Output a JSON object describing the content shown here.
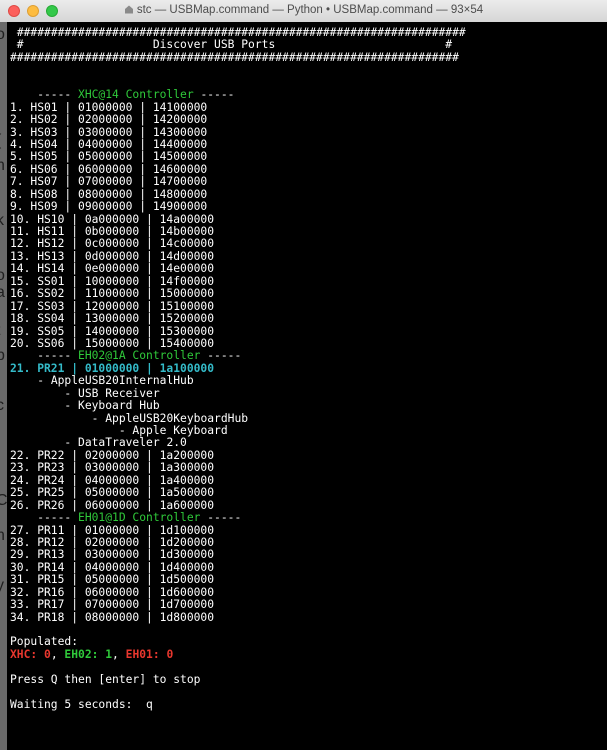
{
  "window": {
    "title": "stc — USBMap.command — Python • USBMap.command — 93×54"
  },
  "colors": {
    "controller_header": "#2fc93a",
    "active_port": "#34bbc9",
    "zero_count": "#e8372e",
    "nonzero_count": "#2fc93a",
    "terminal_bg": "#000000",
    "text": "#ffffff"
  },
  "edge_glyphs": [
    "o",
    "(",
    "n",
    "k",
    "o",
    "a",
    "t",
    "p",
    ".",
    "c",
    ",",
    "'",
    "C",
    "n",
    "y"
  ],
  "terminal": {
    "header": {
      "rule": "##################################################################",
      "title_line": " #                   Discover USB Ports                         #"
    },
    "controllers": [
      {
        "name": "XHC@14 Controller",
        "ports": [
          "1. HS01 | 01000000 | 14100000",
          "2. HS02 | 02000000 | 14200000",
          "3. HS03 | 03000000 | 14300000",
          "4. HS04 | 04000000 | 14400000",
          "5. HS05 | 05000000 | 14500000",
          "6. HS06 | 06000000 | 14600000",
          "7. HS07 | 07000000 | 14700000",
          "8. HS08 | 08000000 | 14800000",
          "9. HS09 | 09000000 | 14900000",
          "10. HS10 | 0a000000 | 14a00000",
          "11. HS11 | 0b000000 | 14b00000",
          "12. HS12 | 0c000000 | 14c00000",
          "13. HS13 | 0d000000 | 14d00000",
          "14. HS14 | 0e000000 | 14e00000",
          "15. SS01 | 10000000 | 14f00000",
          "16. SS02 | 11000000 | 15000000",
          "17. SS03 | 12000000 | 15100000",
          "18. SS04 | 13000000 | 15200000",
          "19. SS05 | 14000000 | 15300000",
          "20. SS06 | 15000000 | 15400000"
        ]
      },
      {
        "name": "EH02@1A Controller",
        "active_port": "21. PR21 | 01000000 | 1a100000",
        "devices": [
          "- AppleUSB20InternalHub",
          "- USB Receiver",
          "- Keyboard Hub",
          "- AppleUSB20KeyboardHub",
          "- Apple Keyboard",
          "- DataTraveler 2.0"
        ],
        "ports": [
          "22. PR22 | 02000000 | 1a200000",
          "23. PR23 | 03000000 | 1a300000",
          "24. PR24 | 04000000 | 1a400000",
          "25. PR25 | 05000000 | 1a500000",
          "26. PR26 | 06000000 | 1a600000"
        ]
      },
      {
        "name": "EH01@1D Controller",
        "ports": [
          "27. PR11 | 01000000 | 1d100000",
          "28. PR12 | 02000000 | 1d200000",
          "29. PR13 | 03000000 | 1d300000",
          "30. PR14 | 04000000 | 1d400000",
          "31. PR15 | 05000000 | 1d500000",
          "32. PR16 | 06000000 | 1d600000",
          "33. PR17 | 07000000 | 1d700000",
          "34. PR18 | 08000000 | 1d800000"
        ]
      }
    ],
    "populated": {
      "label": "Populated:",
      "counts": [
        {
          "name": "XHC",
          "value": "0"
        },
        {
          "name": "EH02",
          "value": "1"
        },
        {
          "name": "EH01",
          "value": "0"
        }
      ]
    },
    "prompt": "Press Q then [enter] to stop",
    "waiting": "Waiting 5 seconds:  q"
  }
}
